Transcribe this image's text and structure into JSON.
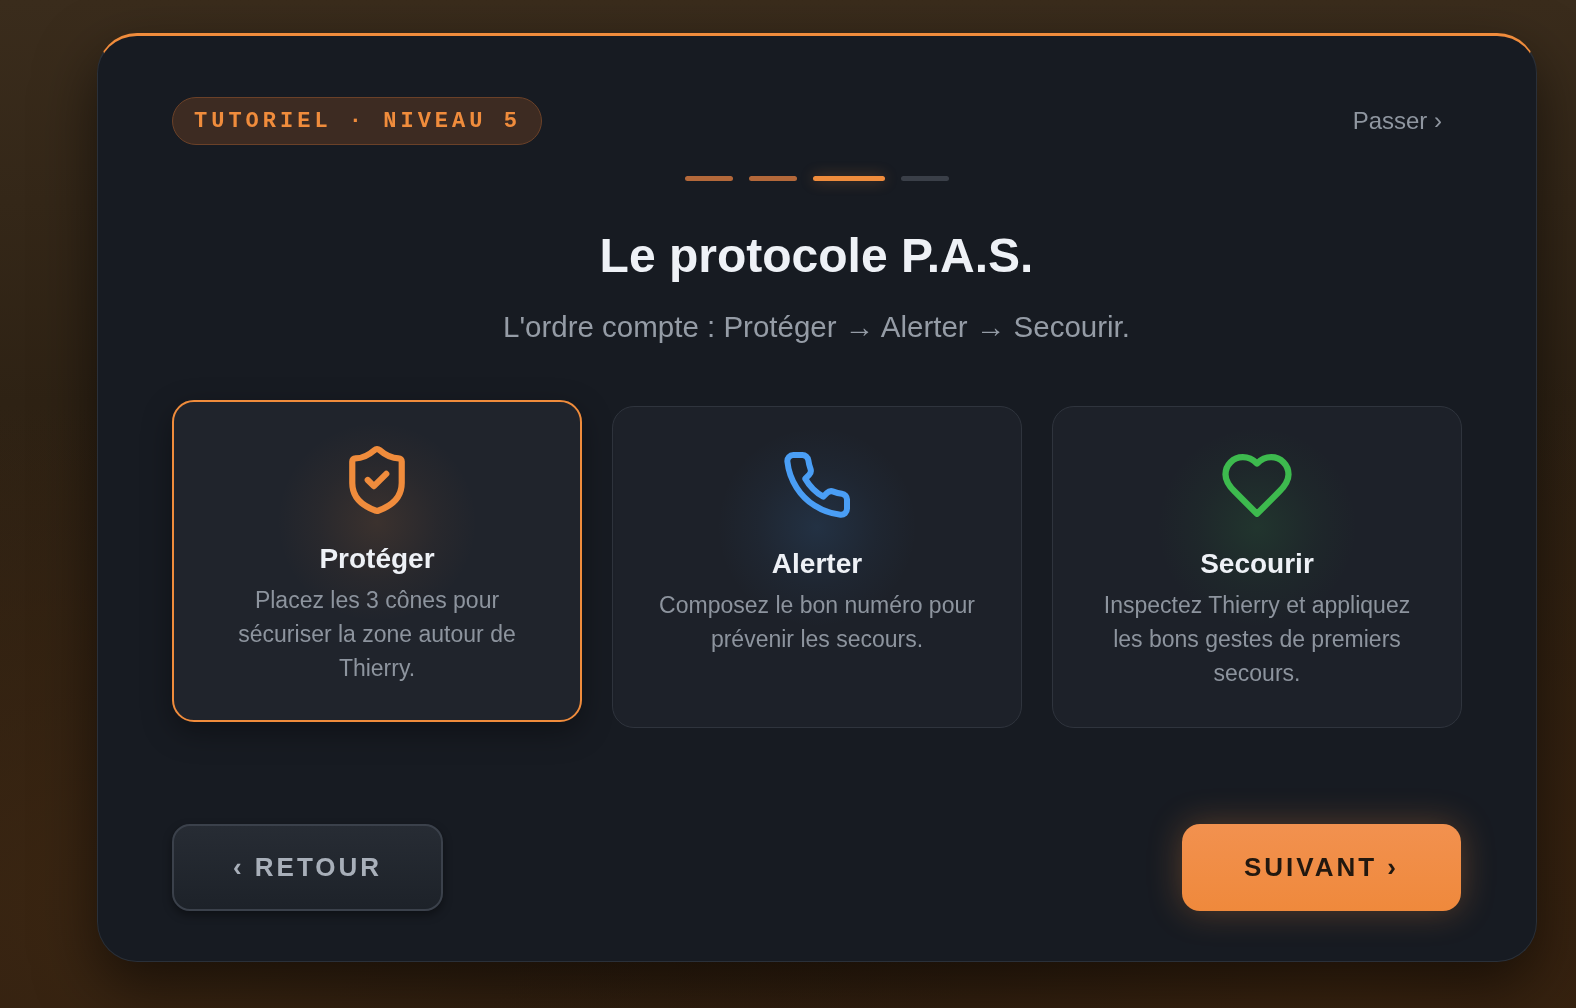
{
  "tutorial_dialog": {
    "badge": "TUTORIEL · NIVEAU 5",
    "skip_link": "Passer ›",
    "progress_steps": [
      {
        "done": true,
        "selected": false
      },
      {
        "done": true,
        "selected": false
      },
      {
        "done": false,
        "selected": true
      },
      {
        "done": false,
        "selected": false
      }
    ],
    "title": "Le protocole P.A.S.",
    "subtitle": "L'ordre compte : Protéger → Alerter → Secourir.",
    "cards": [
      {
        "kind": "shield",
        "color": "#f08c3c",
        "title": "Protéger",
        "description": "Placez les 3 cônes pour sécuriser la zone autour de Thierry.",
        "selected": true
      },
      {
        "kind": "phone",
        "color": "#4a9ef5",
        "title": "Alerter",
        "description": "Composez le bon numéro pour prévenir les secours.",
        "selected": false
      },
      {
        "kind": "heart",
        "color": "#3dba4e",
        "title": "Secourir",
        "description": "Inspectez Thierry et appliquez les bons gestes de premiers secours.",
        "selected": false
      }
    ],
    "buttons": [
      {
        "kind": "secondary",
        "label": "‹ RETOUR"
      },
      {
        "kind": "primary",
        "label": "SUIVANT ›"
      }
    ]
  }
}
